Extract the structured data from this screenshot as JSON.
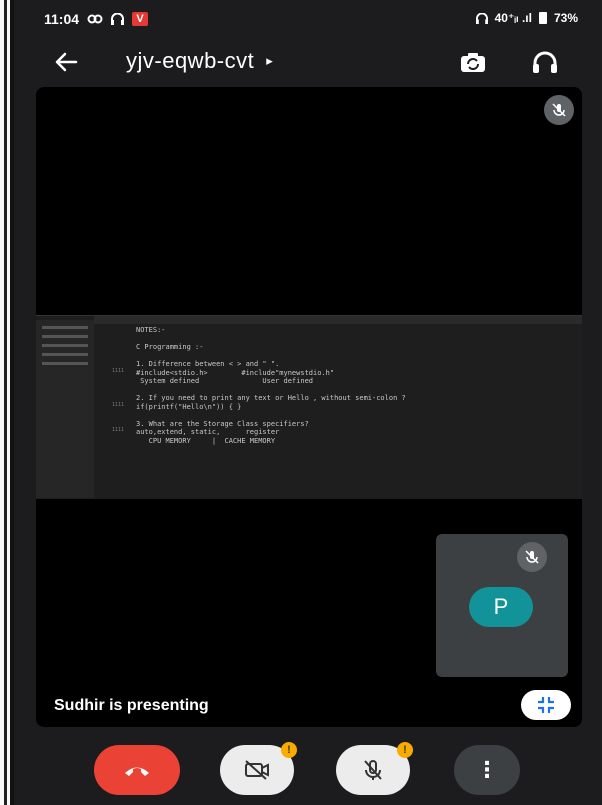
{
  "status_bar": {
    "time": "11:04",
    "right_text": "40⁺ᵢₗ .ıl",
    "battery": "73%",
    "notification_badge": "V"
  },
  "app_bar": {
    "meeting_code": "yjv-eqwb-cvt",
    "caret": "▸",
    "icons": [
      "back-arrow-icon",
      "switch-camera-icon",
      "headphones-icon"
    ]
  },
  "shared_screen": {
    "notes_text": "NOTES:-\n\nC Programming :-\n\n1. Difference between < > and \" \".\n#include<stdio.h>        #include\"mynewstdio.h\"\n System defined               User defined\n\n2. If you need to print any text or Hello , without semi-colon ?\nif(printf(\"Hello\\n\")) { }\n\n3. What are the Storage Class specifiers?\nauto,extend, static,      register\n   CPU MEMORY     |  CACHE MEMORY",
    "gutter_marks": [
      "1111",
      "1111",
      "1111"
    ]
  },
  "self_view": {
    "avatar_initial": "P"
  },
  "presenting_text": "Sudhir is presenting",
  "controls": {
    "camera_badge": "!",
    "mic_badge": "!",
    "more_label": "⋮"
  },
  "colors": {
    "end_call": "#ea4335",
    "avatar": "#12939a",
    "warning_badge": "#f9ab00"
  }
}
